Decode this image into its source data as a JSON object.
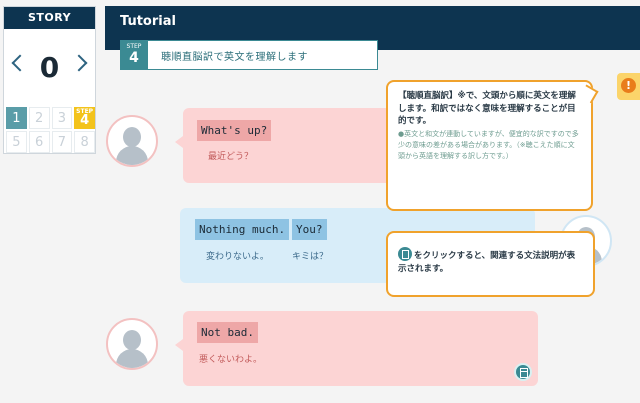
{
  "story": {
    "header": "STORY",
    "number": "0",
    "steps": [
      {
        "label": "1",
        "state": "done"
      },
      {
        "label": "2",
        "state": "todo"
      },
      {
        "label": "3",
        "state": "todo"
      },
      {
        "label": "4",
        "state": "current",
        "mini": "STEP"
      },
      {
        "label": "5",
        "state": "todo"
      },
      {
        "label": "6",
        "state": "todo"
      },
      {
        "label": "7",
        "state": "todo"
      },
      {
        "label": "8",
        "state": "todo"
      }
    ]
  },
  "header": {
    "title": "Tutorial"
  },
  "step_badge": {
    "label": "STEP",
    "number": "4",
    "text": "聴順直脳訳で英文を理解します"
  },
  "dialogue": [
    {
      "words": [
        "What's up?"
      ],
      "translations": [
        "最近どう？"
      ]
    },
    {
      "words": [
        "Nothing much.",
        "You?"
      ],
      "translations": [
        "変わりないよ。",
        "キミは？"
      ]
    },
    {
      "words": [
        "Not bad."
      ],
      "translations": [
        "悪くないわよ。"
      ]
    }
  ],
  "tooltips": {
    "tip1_main": "【聴順直脳訳】※で、文頭から順に英文を理解します。和訳ではなく意味を理解することが目的です。",
    "tip1_sub": "●英文と和文が連動していますが、便宜的な訳ですので多少の意味の差がある場合があります。（※聴こえた順に文頭から英語を理解する訳し方です。）",
    "tip2": "をクリックすると、関連する文法説明が表示されます。"
  },
  "colors": {
    "navy": "#0d3450",
    "teal": "#3b8a93",
    "pink": "#fcd4d4",
    "blue": "#d8edf9",
    "orange": "#f0a22c"
  }
}
